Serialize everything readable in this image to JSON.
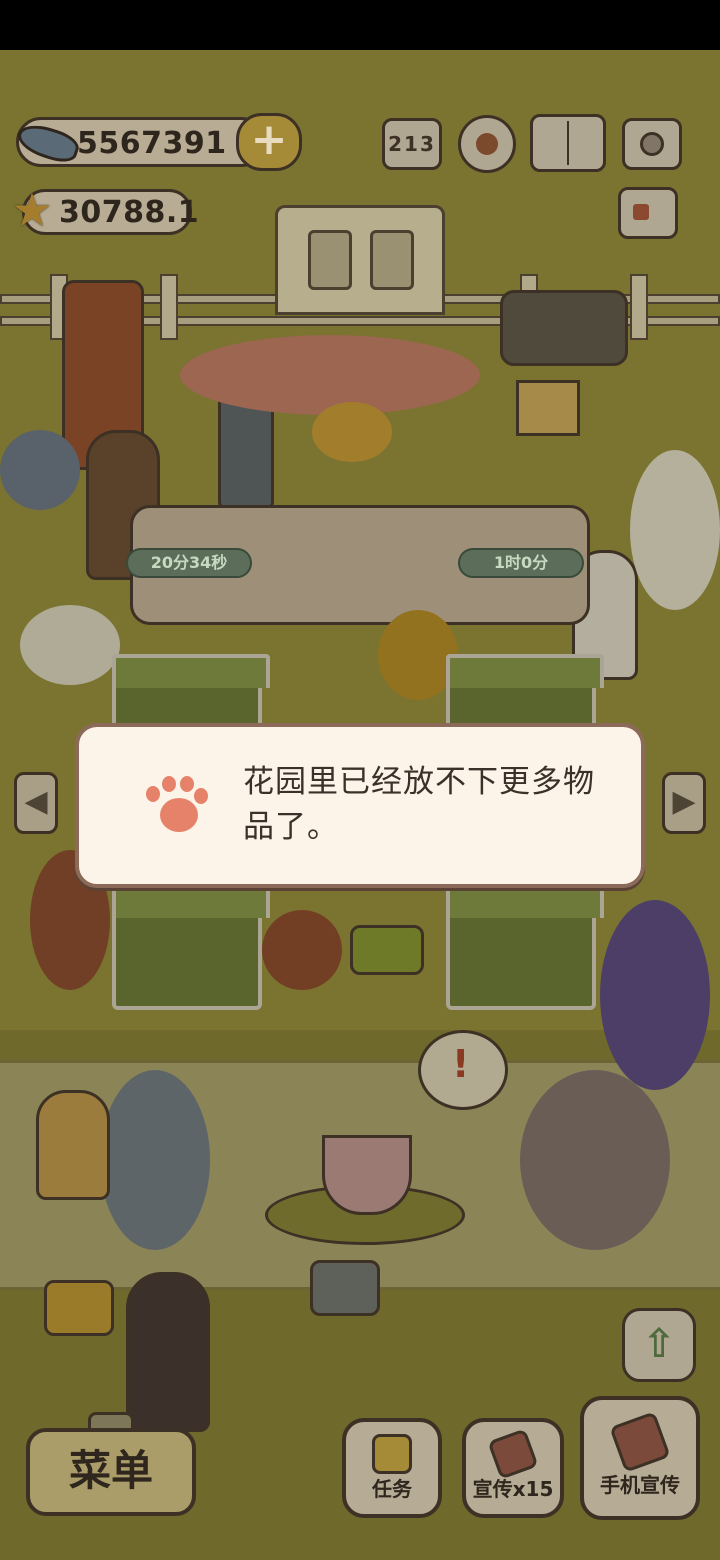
{
  "hud": {
    "fish_count": "5567391",
    "star_count": "30788.1",
    "plus_label": "+",
    "icons": [
      "ranking-icon",
      "settings-gear-icon",
      "catalog-book-icon",
      "camera-icon",
      "profile-card-icon"
    ],
    "ranking_digits": "213"
  },
  "timers": [
    {
      "text": "20分34秒"
    },
    {
      "text": "1时0分"
    }
  ],
  "dialog": {
    "message": "花园里已经放不下更多物品了。",
    "icon": "paw-icon",
    "accent": "#e7826a"
  },
  "nav": {
    "left_arrow": "◀",
    "right_arrow": "▶",
    "up_arrow": "⇧"
  },
  "bottom": {
    "menu_label": "菜单",
    "tasks_label": "任务",
    "promo_label": "宣传x15",
    "phone_promo_label": "手机宣传"
  },
  "bubble": {
    "mark": "!"
  },
  "colors": {
    "lawn": "#7a7430",
    "dialog_bg": "#fcf4e9",
    "dialog_border": "#8b6a5a"
  }
}
